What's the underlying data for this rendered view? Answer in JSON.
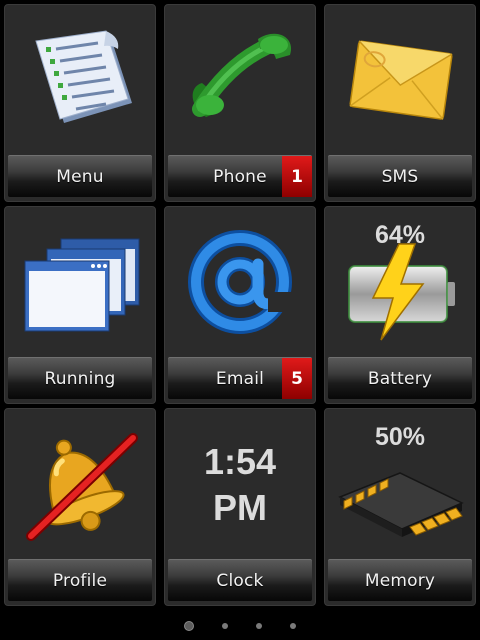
{
  "tiles": {
    "menu": {
      "label": "Menu"
    },
    "phone": {
      "label": "Phone",
      "badge": "1"
    },
    "sms": {
      "label": "SMS"
    },
    "running": {
      "label": "Running"
    },
    "email": {
      "label": "Email",
      "badge": "5"
    },
    "battery": {
      "label": "Battery",
      "value": "64%"
    },
    "profile": {
      "label": "Profile"
    },
    "clock": {
      "label": "Clock",
      "time": "1:54",
      "ampm": "PM"
    },
    "memory": {
      "label": "Memory",
      "value": "50%"
    }
  },
  "icons": {
    "menu": "document-list-icon",
    "phone": "phone-handset-icon",
    "sms": "envelope-icon",
    "running": "windows-stack-icon",
    "email": "at-sign-icon",
    "battery": "battery-charging-icon",
    "profile": "bell-muted-icon",
    "memory": "memory-chip-icon"
  },
  "pager": {
    "page_count": 4,
    "current_page": 1
  },
  "colors": {
    "badge": "#c00000",
    "tile_bg": "#2b2b2b",
    "text": "#f2f2f2"
  }
}
